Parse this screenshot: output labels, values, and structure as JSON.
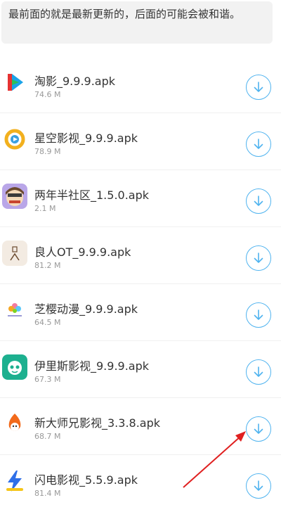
{
  "notice": {
    "text": "最前面的就是最新更新的，后面的可能会被和谐。"
  },
  "apps": [
    {
      "name": "淘影_9.9.9.apk",
      "size": "74.6 M",
      "icon": "taoying-app-icon"
    },
    {
      "name": "星空影视_9.9.9.apk",
      "size": "78.9 M",
      "icon": "xingkong-app-icon"
    },
    {
      "name": "两年半社区_1.5.0.apk",
      "size": "2.1 M",
      "icon": "liangnianban-app-icon"
    },
    {
      "name": "良人OT_9.9.9.apk",
      "size": "81.2 M",
      "icon": "liangren-app-icon"
    },
    {
      "name": "芝樱动漫_9.9.9.apk",
      "size": "64.5 M",
      "icon": "zhiying-app-icon"
    },
    {
      "name": "伊里斯影视_9.9.9.apk",
      "size": "67.3 M",
      "icon": "yilisi-app-icon"
    },
    {
      "name": "新大师兄影视_3.3.8.apk",
      "size": "68.7 M",
      "icon": "dashixiong-app-icon"
    },
    {
      "name": "闪电影视_5.5.9.apk",
      "size": "81.4 M",
      "icon": "shandian-app-icon"
    }
  ],
  "download_icon": "download-arrow-icon",
  "annotation": {
    "icon": "red-pointer-arrow",
    "color": "#e02020"
  },
  "colors": {
    "accent": "#4fb3ef",
    "notice_bg": "#f2f2f2",
    "size_text": "#999999"
  }
}
